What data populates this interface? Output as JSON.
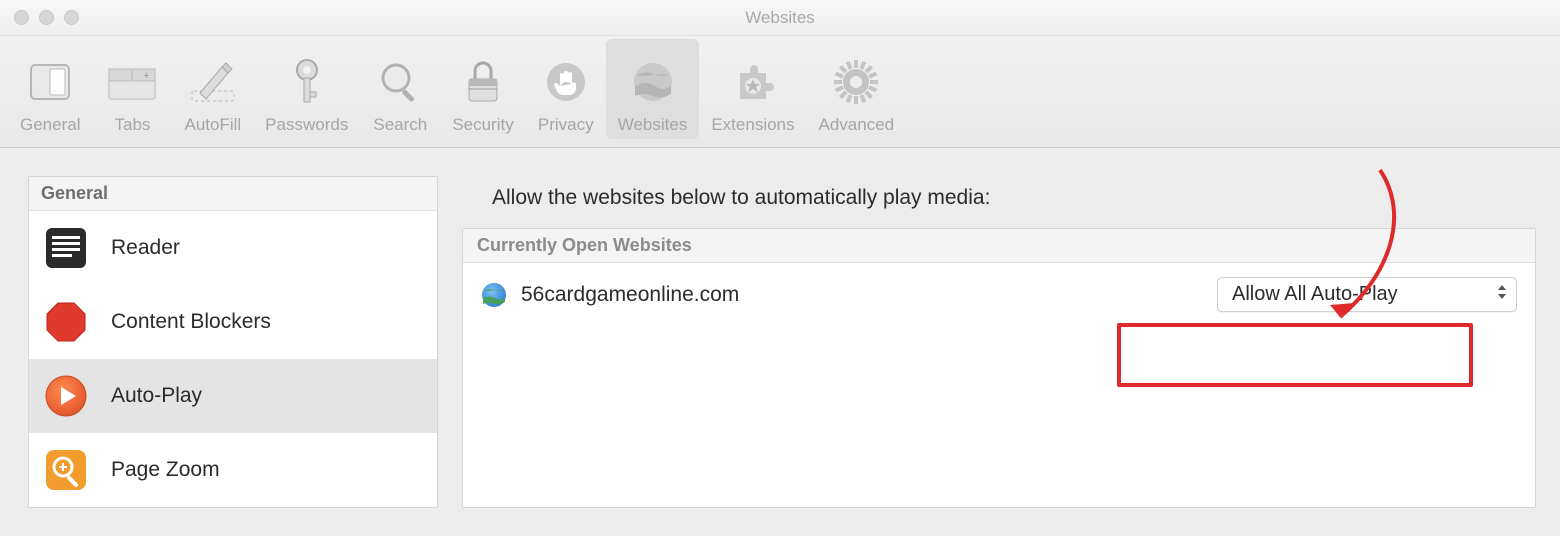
{
  "window": {
    "title": "Websites"
  },
  "toolbar": {
    "tabs": [
      {
        "label": "General"
      },
      {
        "label": "Tabs"
      },
      {
        "label": "AutoFill"
      },
      {
        "label": "Passwords"
      },
      {
        "label": "Search"
      },
      {
        "label": "Security"
      },
      {
        "label": "Privacy"
      },
      {
        "label": "Websites"
      },
      {
        "label": "Extensions"
      },
      {
        "label": "Advanced"
      }
    ]
  },
  "sidebar": {
    "section": "General",
    "items": [
      {
        "label": "Reader"
      },
      {
        "label": "Content Blockers"
      },
      {
        "label": "Auto-Play"
      },
      {
        "label": "Page Zoom"
      }
    ]
  },
  "main": {
    "heading": "Allow the websites below to automatically play media:",
    "panel_header": "Currently Open Websites",
    "site": {
      "name": "56cardgameonline.com",
      "setting": "Allow All Auto-Play"
    }
  }
}
